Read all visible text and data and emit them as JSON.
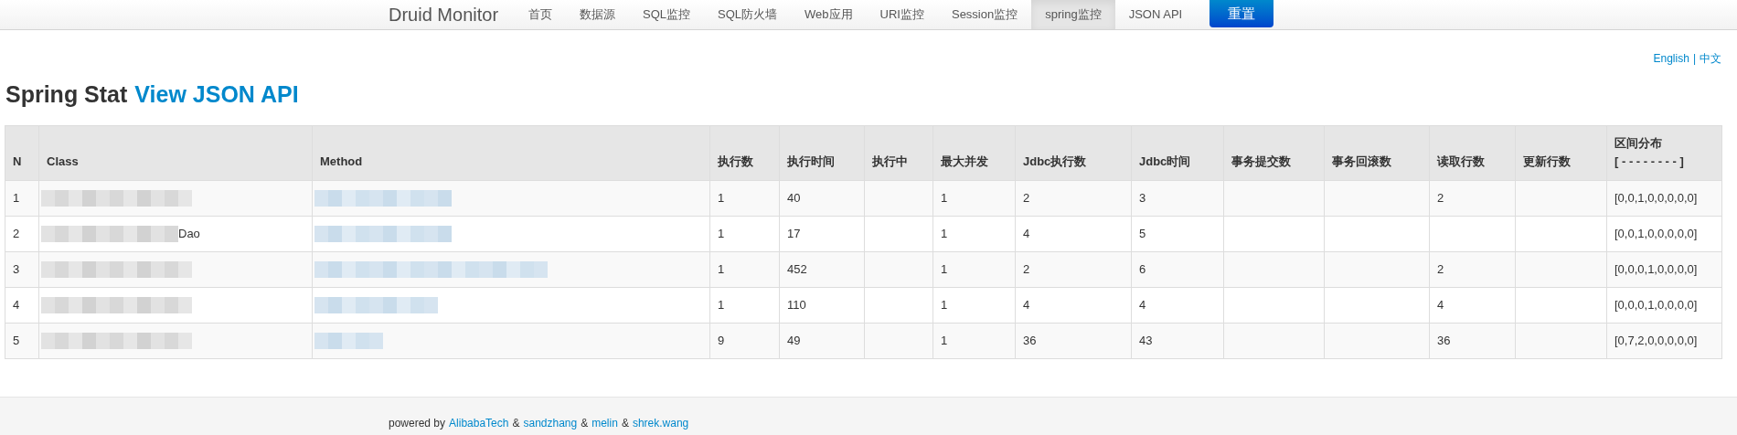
{
  "navbar": {
    "brand": "Druid Monitor",
    "items": [
      {
        "label": "首页",
        "selected": false
      },
      {
        "label": "数据源",
        "selected": false
      },
      {
        "label": "SQL监控",
        "selected": false
      },
      {
        "label": "SQL防火墙",
        "selected": false
      },
      {
        "label": "Web应用",
        "selected": false
      },
      {
        "label": "URI监控",
        "selected": false
      },
      {
        "label": "Session监控",
        "selected": false
      },
      {
        "label": "spring监控",
        "selected": true
      },
      {
        "label": "JSON API",
        "selected": false
      }
    ],
    "reset_button": "重置"
  },
  "languages": [
    {
      "label": "English"
    },
    {
      "label": "中文"
    }
  ],
  "language_separator": "|",
  "heading": {
    "title": "Spring Stat",
    "link": "View JSON API"
  },
  "table": {
    "columns": [
      "N",
      "Class",
      "Method",
      "执行数",
      "执行时间",
      "执行中",
      "最大并发",
      "Jdbc执行数",
      "Jdbc时间",
      "事务提交数",
      "事务回滚数",
      "读取行数",
      "更新行数",
      "区间分布"
    ],
    "column_14_subtitle": "[ - - - - - - - - ]",
    "rows": [
      {
        "class_blurred": true,
        "method_blurred": true,
        "cells": [
          "1",
          "",
          "",
          "1",
          "40",
          "",
          "1",
          "2",
          "3",
          "",
          "",
          "2",
          "",
          "[0,0,1,0,0,0,0,0]"
        ]
      },
      {
        "class_blurred": true,
        "method_blurred": true,
        "cells": [
          "2",
          "Dao",
          "",
          "1",
          "17",
          "",
          "1",
          "4",
          "5",
          "",
          "",
          "",
          "",
          "[0,0,1,0,0,0,0,0]"
        ]
      },
      {
        "class_blurred": true,
        "method_blurred": true,
        "cells": [
          "3",
          "",
          "",
          "1",
          "452",
          "",
          "1",
          "2",
          "6",
          "",
          "",
          "2",
          "",
          "[0,0,0,1,0,0,0,0]"
        ]
      },
      {
        "class_blurred": true,
        "method_blurred": true,
        "cells": [
          "4",
          "",
          "",
          "1",
          "110",
          "",
          "1",
          "4",
          "4",
          "",
          "",
          "4",
          "",
          "[0,0,0,1,0,0,0,0]"
        ]
      },
      {
        "class_blurred": true,
        "method_blurred": true,
        "cells": [
          "5",
          "",
          "",
          "9",
          "49",
          "",
          "1",
          "36",
          "43",
          "",
          "",
          "36",
          "",
          "[0,7,2,0,0,0,0,0]"
        ]
      }
    ]
  },
  "footer": {
    "prefix": "powered by",
    "links": [
      "AlibabaTech",
      "sandzhang",
      "melin",
      "shrek.wang"
    ],
    "separator": "&"
  }
}
